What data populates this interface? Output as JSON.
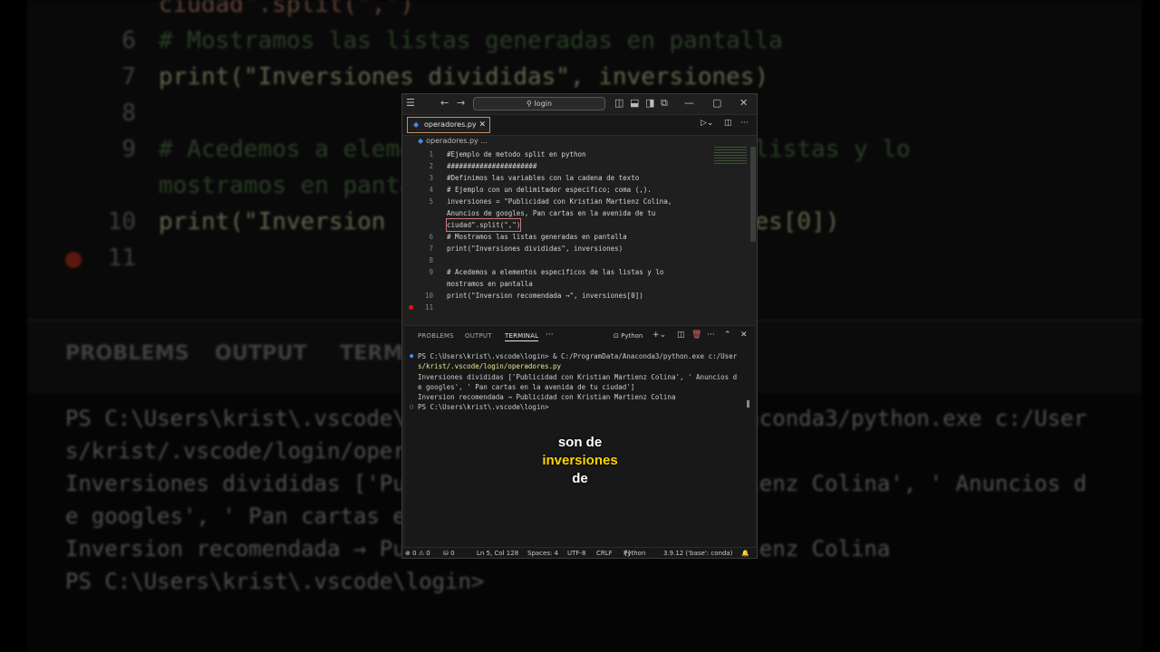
{
  "window": {
    "search_label": "login",
    "tab_label": "operadores.py",
    "breadcrumb": "operadores.py",
    "breadcrumb_more": "..."
  },
  "code_lines": [
    {
      "n": "1",
      "text": "#Ejemplo de metodo split en python"
    },
    {
      "n": "2",
      "text": "######################"
    },
    {
      "n": "3",
      "text": "#Definimos las variables con la cadena de texto"
    },
    {
      "n": "4",
      "text": "# Ejemplo con un delimitador especifico; coma (,)."
    },
    {
      "n": "5",
      "text": "inversiones = \"Publicidad con Kristian Martienz Colina,"
    },
    {
      "n": "",
      "text": "Anuncios de googles, Pan cartas en la avenida de tu"
    },
    {
      "n": "",
      "text": "ciudad\".split(\",\")"
    },
    {
      "n": "6",
      "text": "# Mostramos las listas generadas en pantalla"
    },
    {
      "n": "7",
      "text": "print(\"Inversiones divididas\", inversiones)"
    },
    {
      "n": "8",
      "text": ""
    },
    {
      "n": "9",
      "text": "# Acedemos a elementos especificos de las listas y lo"
    },
    {
      "n": "",
      "text": "mostramos en pantalla"
    },
    {
      "n": "10",
      "text": "print(\"Inversion recomendada →\", inversiones[0])"
    },
    {
      "n": "11",
      "text": ""
    }
  ],
  "panel": {
    "tabs": [
      "PROBLEMS",
      "OUTPUT",
      "TERMINAL"
    ],
    "shell_label": "Python",
    "more": "···"
  },
  "terminal": [
    "PS C:\\Users\\krist\\.vscode\\login> & C:/ProgramData/Anaconda3/python.exe c:/User",
    "s/krist/.vscode/login/operadores.py",
    "Inversiones divididas ['Publicidad con Kristian Martienz Colina', ' Anuncios d",
    "e googles', ' Pan cartas en la avenida de tu ciudad']",
    "Inversion recomendada → Publicidad con Kristian Martienz Colina",
    "PS C:\\Users\\krist\\.vscode\\login>"
  ],
  "status": {
    "errors": "⊗ 0 ⚠ 0",
    "ports": "⛁ 0",
    "position": "Ln 5, Col 128",
    "spaces": "Spaces: 4",
    "encoding": "UTF-8",
    "eol": "CRLF",
    "language": "Python",
    "interpreter": "3.9.12 ('base': conda)"
  },
  "captions": [
    "son de",
    "inversiones",
    "de"
  ],
  "background": {
    "lines": [
      {
        "n": "6",
        "text": "# Mostramos las listas generadas en pantalla"
      },
      {
        "n": "7",
        "text": "print(\"Inversiones divididas\", inversiones)"
      },
      {
        "n": "8",
        "text": ""
      },
      {
        "n": "9",
        "text": "# Acedemos a elementos especificos de las listas y lo"
      },
      {
        "n": "",
        "text": "mostramos en pantalla"
      },
      {
        "n": "10",
        "text": "print(\"Inversion recomendada →\", inversiones[0])"
      },
      {
        "n": "11",
        "text": ""
      }
    ],
    "top_fragment": "ciudad\".split(\",\")",
    "panel_tabs": [
      "PROBLEMS",
      "OUTPUT",
      "TERMINAL"
    ],
    "terminal": [
      "PS C:\\Users\\krist\\.vscode\\login> & C:/ProgramData/Anaconda3/python.exe c:/User",
      "s/krist/.vscode/login/operadores.py",
      "Inversiones divididas ['Publicidad con Kristian Martienz Colina', ' Anuncios d",
      "e googles', ' Pan cartas en la avenida de tu ciudad']",
      "Inversion recomendada → Publicidad con Kristian Martienz Colina",
      "PS C:\\Users\\krist\\.vscode\\login>"
    ]
  }
}
